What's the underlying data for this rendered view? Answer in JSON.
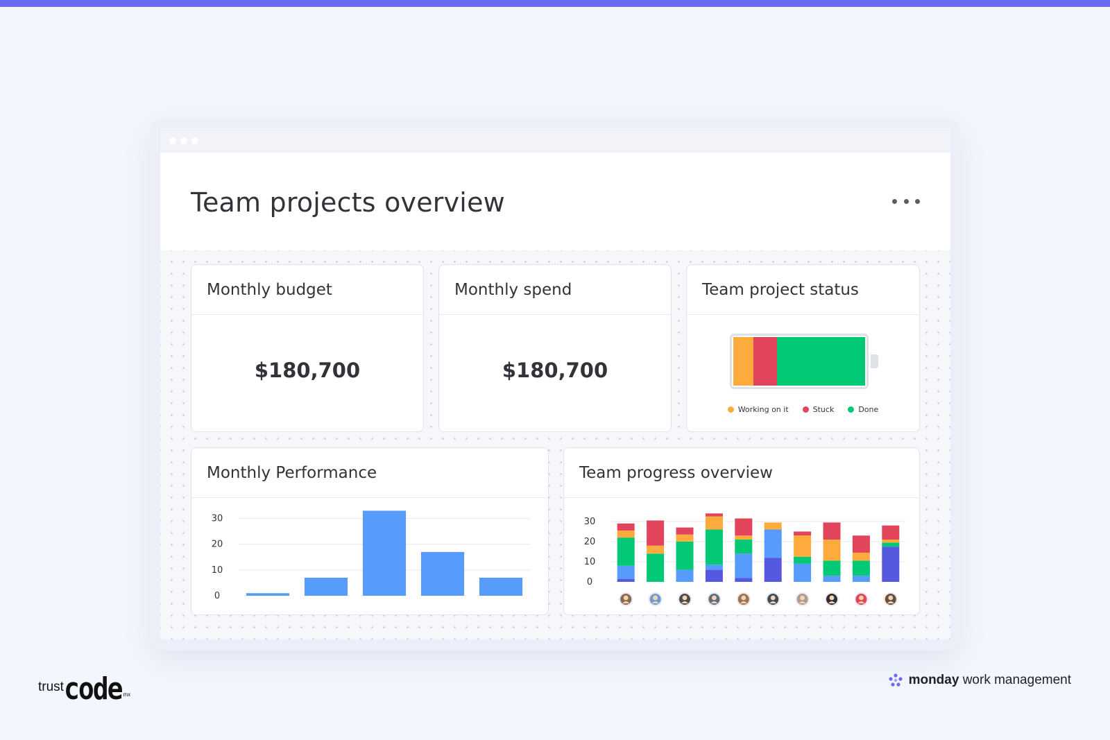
{
  "page": {
    "title": "Team projects overview"
  },
  "widgets": {
    "budget": {
      "title": "Monthly budget",
      "value": "$180,700"
    },
    "spend": {
      "title": "Monthly spend",
      "value": "$180,700"
    },
    "status": {
      "title": "Team project status",
      "legend": [
        {
          "label": "Working on it",
          "color": "#fdab3d",
          "share": 0.15
        },
        {
          "label": "Stuck",
          "color": "#e2445c",
          "share": 0.18
        },
        {
          "label": "Done",
          "color": "#00c875",
          "share": 0.67
        }
      ]
    },
    "performance": {
      "title": "Monthly Performance"
    },
    "team": {
      "title": "Team progress overview"
    }
  },
  "chart_data": [
    {
      "type": "bar",
      "categories": [
        "",
        "",
        "",
        "",
        ""
      ],
      "values": [
        1,
        7,
        33,
        17,
        7
      ],
      "ylim": [
        0,
        35
      ],
      "yticks": [
        "30",
        "20",
        "10",
        "0"
      ],
      "ytick_values": [
        30,
        20,
        10,
        0
      ],
      "color": "#579bfc",
      "grid": true
    },
    {
      "type": "bar",
      "stacked": true,
      "categories": [
        "avatar-1",
        "avatar-2",
        "avatar-3",
        "avatar-4",
        "avatar-5",
        "avatar-6",
        "avatar-7",
        "avatar-8",
        "avatar-9",
        "avatar-10"
      ],
      "ylim": [
        0,
        32
      ],
      "yticks": [
        "30",
        "20",
        "10",
        "0"
      ],
      "ytick_values": [
        30,
        20,
        10,
        0
      ],
      "grid": true,
      "series": [
        {
          "color": "#5559df",
          "values": [
            1.5,
            0,
            0,
            6,
            2,
            12,
            0,
            0,
            0,
            17.5
          ]
        },
        {
          "color": "#579bfc",
          "values": [
            6.5,
            0,
            6,
            2.5,
            12,
            14,
            9,
            3,
            3,
            0
          ]
        },
        {
          "color": "#03c875",
          "values": [
            14,
            14,
            14,
            17.5,
            7,
            0,
            3.5,
            7.5,
            7.5,
            2
          ]
        },
        {
          "color": "#fdab3d",
          "values": [
            3.5,
            4,
            3.5,
            6.5,
            2,
            3.5,
            10.5,
            10.5,
            4,
            1.5
          ]
        },
        {
          "color": "#e2445c",
          "values": [
            3.5,
            12.5,
            3.5,
            1.5,
            8.5,
            0,
            2,
            8.5,
            8.5,
            7
          ]
        }
      ],
      "avatar_colors": [
        "#8a6b52",
        "#6f9ccf",
        "#4d4d4d",
        "#5b6f7c",
        "#9a7455",
        "#3f4d57",
        "#b29b87",
        "#2f2f2f",
        "#e2445c",
        "#6b4f3b"
      ]
    }
  ],
  "footer": {
    "left_brand_trust": "trust",
    "left_brand_code": "code",
    "left_brand_mx": "mx",
    "right_brand_bold": "monday",
    "right_brand_rest": "work management"
  }
}
